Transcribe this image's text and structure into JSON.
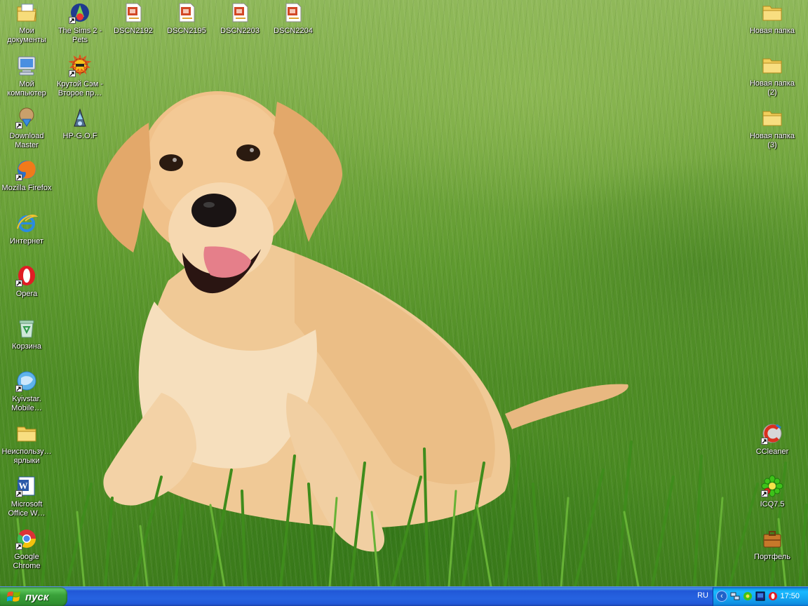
{
  "desktop": {
    "left_column": [
      {
        "label": "Мои документы",
        "icon": "my-documents-icon",
        "shortcut": false
      },
      {
        "label": "Мой компьютер",
        "icon": "my-computer-icon",
        "shortcut": false
      },
      {
        "label": "Download Master",
        "icon": "download-master-icon",
        "shortcut": true
      },
      {
        "label": "Mozilla Firefox",
        "icon": "firefox-icon",
        "shortcut": true
      },
      {
        "label": "Интернет",
        "icon": "internet-explorer-icon",
        "shortcut": false
      },
      {
        "label": "Opera",
        "icon": "opera-icon",
        "shortcut": true
      },
      {
        "label": "Корзина",
        "icon": "recycle-bin-icon",
        "shortcut": false
      },
      {
        "label": "Kyivstar. Mobile…",
        "icon": "kyivstar-icon",
        "shortcut": true
      },
      {
        "label": "Неиспользу… ярлыки",
        "icon": "folder-icon",
        "shortcut": false
      },
      {
        "label": "Microsoft Office W…",
        "icon": "word-icon",
        "shortcut": true
      },
      {
        "label": "Google Chrome",
        "icon": "chrome-icon",
        "shortcut": true
      }
    ],
    "second_column": [
      {
        "label": "The Sims 2 - Pets",
        "icon": "sims2-icon",
        "shortcut": true
      },
      {
        "label": "Крутой Сэм - Второе пр…",
        "icon": "serious-sam-icon",
        "shortcut": true
      },
      {
        "label": "HP-G.O.F",
        "icon": "hp-gof-icon",
        "shortcut": false
      }
    ],
    "top_row": [
      {
        "label": "DSCN2192",
        "icon": "powerpoint-file-icon"
      },
      {
        "label": "DSCN2195",
        "icon": "powerpoint-file-icon"
      },
      {
        "label": "DSCN2203",
        "icon": "powerpoint-file-icon"
      },
      {
        "label": "DSCN2204",
        "icon": "powerpoint-file-icon"
      }
    ],
    "right_column_top": [
      {
        "label": "Новая папка",
        "icon": "folder-icon"
      },
      {
        "label": "Новая папка (2)",
        "icon": "folder-icon"
      },
      {
        "label": "Новая папка (3)",
        "icon": "folder-icon"
      }
    ],
    "right_column_bottom": [
      {
        "label": "CCleaner",
        "icon": "ccleaner-icon",
        "shortcut": true
      },
      {
        "label": "ICQ7.5",
        "icon": "icq-icon",
        "shortcut": true
      },
      {
        "label": "Портфель",
        "icon": "briefcase-icon",
        "shortcut": false
      }
    ]
  },
  "taskbar": {
    "start_label": "пуск",
    "language": "RU",
    "clock": "17:50",
    "tray_icons": [
      "show-hidden-icons-chevron",
      "network-icon",
      "icq-tray-icon",
      "monitor-tray-icon",
      "opera-tray-icon"
    ]
  },
  "colors": {
    "taskbar_blue": "#2663e0",
    "start_green": "#3aa23a",
    "tray_blue": "#14a5f0",
    "label_text": "#ffffff"
  }
}
